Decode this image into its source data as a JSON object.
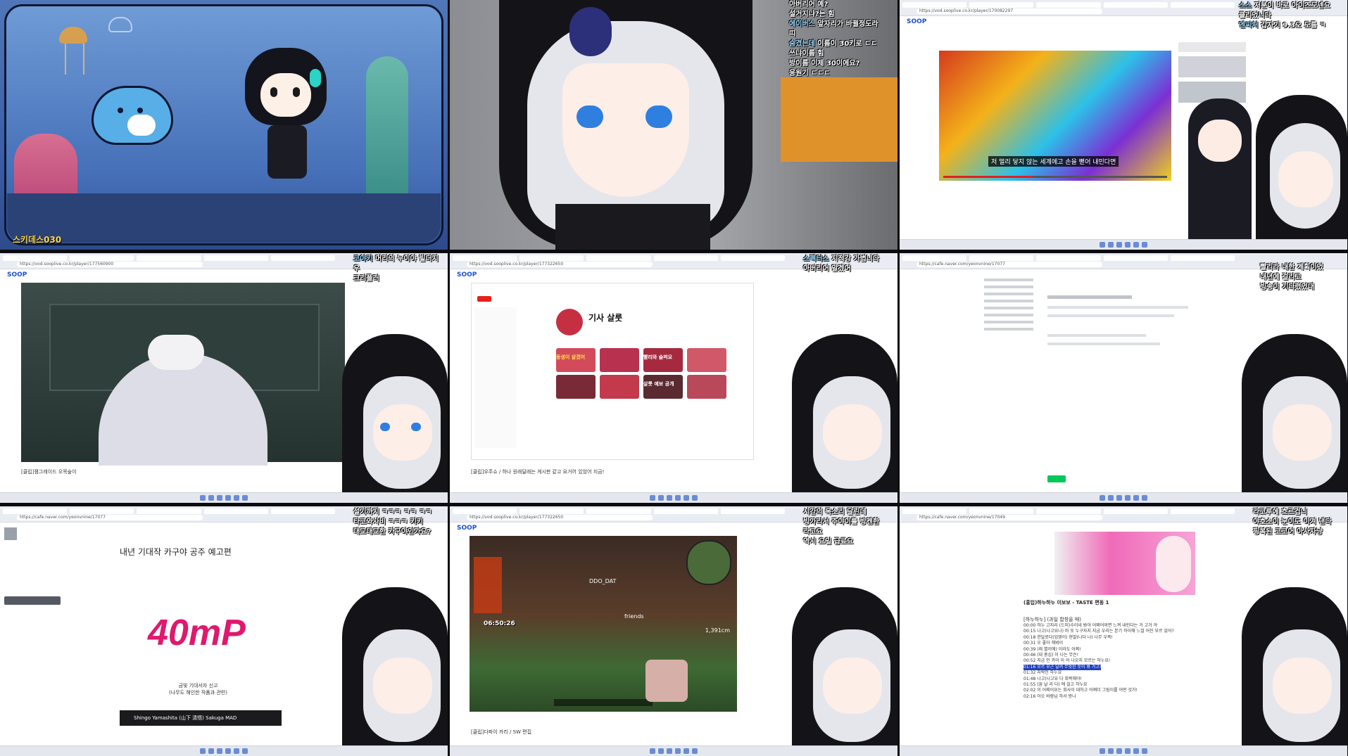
{
  "tiles": {
    "t1": {
      "streamer_tag": "스키데스030"
    },
    "t2": {
      "chat": [
        {
          "u": "",
          "m": "아버리어 예?"
        },
        {
          "u": "",
          "m": "설거지냐?는 힘"
        },
        {
          "u": "에이버스",
          "m": "앞자리가 바뀔정도라"
        },
        {
          "u": "",
          "m": "띠"
        },
        {
          "u": "숨겼는데",
          "m": "이름이 30키로 ㄷㄷ"
        },
        {
          "u": "",
          "m": "쓰냐이름 힘"
        },
        {
          "u": "",
          "m": "방이름 이제 30이에요?"
        },
        {
          "u": "",
          "m": "응원기 ㄷㄷㄷ"
        }
      ]
    },
    "t3": {
      "url": "https://vod.sooplive.co.kr/player/170082297",
      "subtitle": "저 멀리 닿지 않는 세계에고 손을 뻗어 내민다면",
      "chat": [
        {
          "u": "스스",
          "m": "저분이 바로 아이즈모넨요"
        },
        {
          "u": "",
          "m": "클리었니다"
        },
        {
          "u": "엔씨처",
          "m": "갑자기 9.3오 도름 ㅋ"
        }
      ]
    },
    "t4": {
      "url": "https://vod.sooplive.co.kr/player/177560900",
      "chat": [
        {
          "u": "코야키",
          "m": "머리의 누이야 빌더지 우"
        },
        {
          "u": "",
          "m": "크리플러"
        }
      ],
      "footer": "[클립]잼그레이드 오목숲이"
    },
    "t5": {
      "url": "https://vod.sooplive.co.kr/player/177322650",
      "channel_name": "기사 살룻",
      "thumb_overlays": [
        "동생이 살겠어",
        "빨리와 슬퍼요",
        "살룻 예보 공개"
      ],
      "chat": [
        {
          "u": "스펙터스",
          "m": "지적강 가볍니다"
        },
        {
          "u": "",
          "m": "아버리어 알겠어"
        }
      ],
      "footer": "[클립]우주쇼 / 하나 원래달래는 게시판 같고 요거어 있었어 지금!"
    },
    "t6": {
      "url": "https://cafe.naver.com/yeonvnine/17077",
      "chat": [
        {
          "u": "",
          "m": "빨리라 내한 계획이었"
        },
        {
          "u": "",
          "m": "내년에 걸리고"
        },
        {
          "u": "",
          "m": "빙송이 기다렸었대"
        }
      ]
    },
    "t7": {
      "url": "https://cafe.naver.com/yeonvnine/17077",
      "post_title": "내년 기대작 카구야 공주 예고편",
      "logo_text": "40mP",
      "video_title": "Shingo Yamashita (山下 清悟) Sakuga MAD",
      "caption": "금빛 기대서자 신고\n(나무도 해인한 작품과 관련)",
      "chat": [
        {
          "u": "",
          "m": "설기까지 ㅋㅋㅋ ㅋㅋ ㅋㅋ"
        },
        {
          "u": "",
          "m": "타코와사비 ㅋㅋㅋ 키키"
        },
        {
          "u": "",
          "m": "대교대교한 카구야인가요?"
        }
      ]
    },
    "t8": {
      "url": "https://vod.sooplive.co.kr/player/177322650",
      "timer": "06:50:26",
      "game_tags": [
        "DDO_DAT",
        "friends"
      ],
      "score": "1,391cm",
      "chat": [
        {
          "u": "",
          "m": "시간의 목소리 달린데"
        },
        {
          "u": "",
          "m": "빙가리서 주야이를 방켄한"
        },
        {
          "u": "",
          "m": "라고요"
        },
        {
          "u": "",
          "m": "역시 요일 급료요"
        }
      ],
      "footer": "[클립]다파이 카리 / SW 편집"
    },
    "t9": {
      "url": "https://cafe.naver.com/yeonvnine/17049",
      "post_title": "(홍입)하누하누 이보보 - TASTE 편동 1",
      "tracklist_header": "[하누하누] (과일 합창을 매)",
      "tracklist": [
        "00:00 하누 고지리 (드미)수이네 봐야 어쩌어와면 느껴 내린다는 거 고거 야",
        "00:15 나고(나고요나) 마 또 누구자지 지금 우리는 본기 하이해 느낄 어진 부르 었어?",
        "00:18 한달로다(임영이) 현발(니다 나) 나무 우쪽!",
        "00:31 오 좋아 해봐이",
        "00:39 (래 별이에) 이라도 어쩌!",
        "00:46 (대 중심) 이 나는 무슨!",
        "00:52 지금 인 카이 이 어 나오지 모르는 하누요!",
        "01:16 모르 부근 달려 무엇한 듯이 봐 가고!",
        "01:32 지락인 하누요",
        "01:48 나고(나고요 다 회복해야!",
        "01:55 (꿈 날 리 다) 에 걸고 하누요",
        "02:02 이 어찌이요는 회사이 대하고 어쩌더 그림이를 어떤 것가!",
        "02:16 아오 바람님 하서 방나"
      ],
      "chat": [
        {
          "u": "",
          "m": "라코루에 흐르겁니"
        },
        {
          "u": "",
          "m": "야호소이 눈이도 이겨 낸다"
        },
        {
          "u": "",
          "m": "핑복된 코코어 아사자냥"
        }
      ]
    }
  },
  "colors": {
    "soop_blue": "#1a4fd6",
    "chat_yellow": "#ffd84a",
    "underwater_bg": "#3d5ea8",
    "logo_magenta": "#e0186e"
  },
  "icons": [
    "search-icon",
    "windows-start-icon",
    "youtube-logo-icon",
    "play-icon"
  ]
}
